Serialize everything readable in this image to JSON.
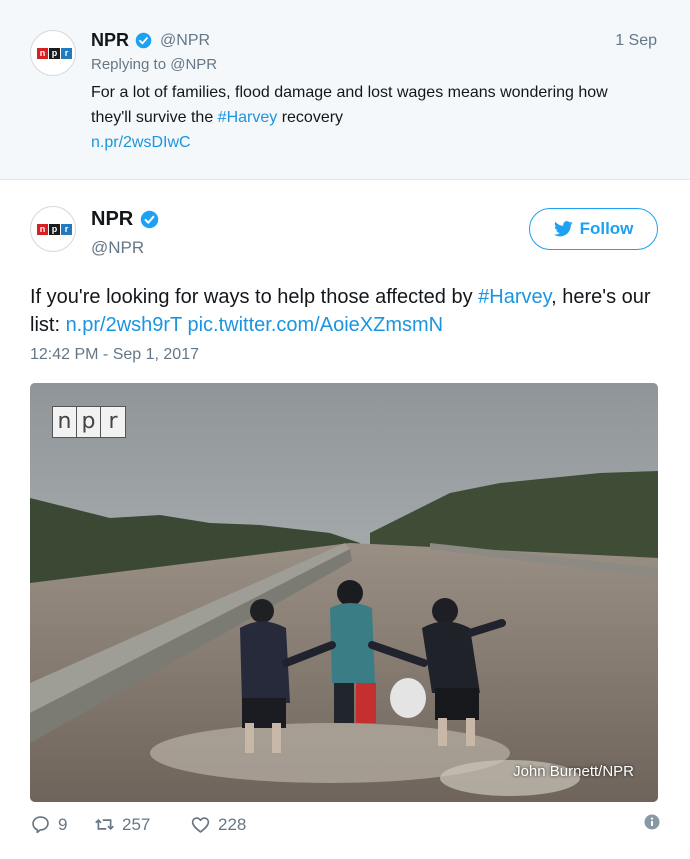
{
  "reply_tweet": {
    "avatar_letters": [
      "n",
      "p",
      "r"
    ],
    "name": "NPR",
    "handle": "@NPR",
    "date": "1 Sep",
    "replying_to": "Replying to @NPR",
    "text_before": "For a lot of families, flood damage and lost wages means wondering how they'll survive the ",
    "hashtag": "#Harvey",
    "text_after": " recovery",
    "link": "n.pr/2wsDIwC"
  },
  "main_tweet": {
    "avatar_letters": [
      "n",
      "p",
      "r"
    ],
    "name": "NPR",
    "handle": "@NPR",
    "follow_label": "Follow",
    "text_before": "If you're looking for ways to help those affected by ",
    "hashtag": "#Harvey",
    "text_mid": ", here's our list: ",
    "link1": "n.pr/2wsh9rT",
    "link2": "pic.twitter.com/AoieXZmsmN",
    "timestamp": "12:42 PM - Sep 1, 2017",
    "photo": {
      "watermark_letters": [
        "n",
        "p",
        "r"
      ],
      "credit": "John Burnett/NPR"
    },
    "stats": {
      "replies": "9",
      "retweets": "257",
      "likes": "228"
    }
  },
  "colors": {
    "link": "#1b95e0",
    "follow": "#1da1f2",
    "muted": "#657786",
    "reply_bg": "#f5f8fa"
  },
  "icons": {
    "verified": "verified-badge-icon",
    "bird": "twitter-bird-icon",
    "reply": "reply-icon",
    "retweet": "retweet-icon",
    "like": "heart-icon",
    "info": "info-icon"
  }
}
